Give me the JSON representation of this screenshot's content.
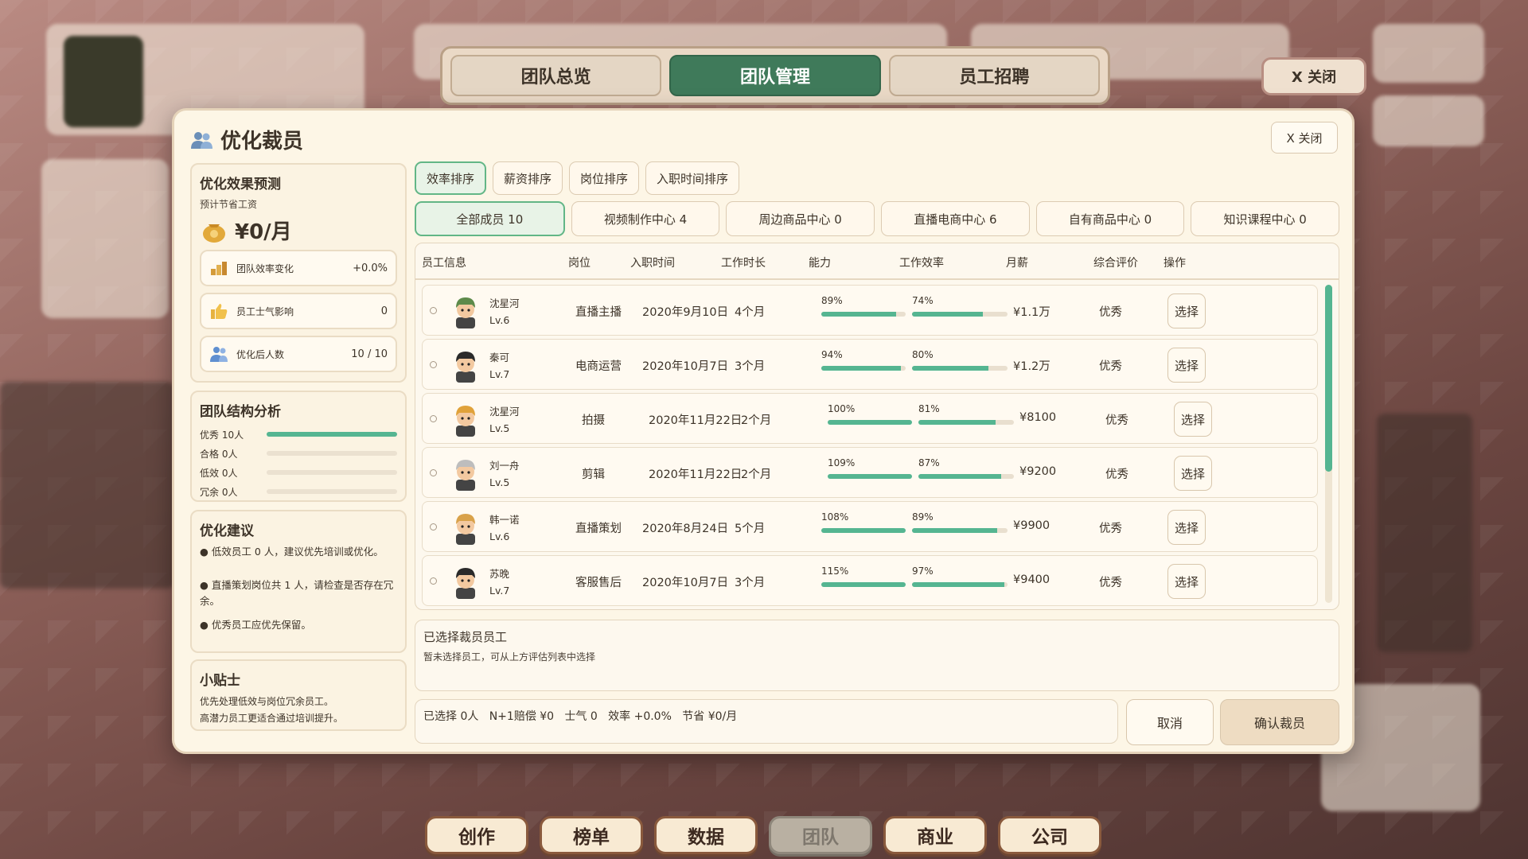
{
  "top_tabs": [
    {
      "label": "团队总览",
      "active": false
    },
    {
      "label": "团队管理",
      "active": true
    },
    {
      "label": "员工招聘",
      "active": false
    }
  ],
  "top_close_label": "X 关闭",
  "modal": {
    "title": "优化裁员",
    "close_label": "X 关闭",
    "left": {
      "forecast": {
        "title": "优化效果预测",
        "subtitle": "预计节省工资",
        "value": "¥0/月",
        "stats": [
          {
            "icon": "team-efficiency-icon",
            "label": "团队效率变化",
            "value": "+0.0%"
          },
          {
            "icon": "thumbs-up-icon",
            "label": "员工士气影响",
            "value": "0"
          },
          {
            "icon": "people-icon",
            "label": "优化后人数",
            "value": "10 / 10"
          }
        ]
      },
      "structure": {
        "title": "团队结构分析",
        "rows": [
          {
            "label": "优秀  10人",
            "fraction": 1.0
          },
          {
            "label": "合格  0人",
            "fraction": 0
          },
          {
            "label": "低效  0人",
            "fraction": 0
          },
          {
            "label": "冗余  0人",
            "fraction": 0
          }
        ]
      },
      "suggestions": {
        "title": "优化建议",
        "items": [
          "● 低效员工 0 人，建议优先培训或优化。",
          "● 直播策划岗位共 1 人，请检查是否存在冗余。",
          "● 优秀员工应优先保留。"
        ]
      },
      "tips": {
        "title": "小贴士",
        "lines": [
          "优先处理低效与岗位冗余员工。",
          "高潜力员工更适合通过培训提升。"
        ]
      }
    },
    "sort_buttons": [
      {
        "label": "效率排序",
        "active": true
      },
      {
        "label": "薪资排序",
        "active": false
      },
      {
        "label": "岗位排序",
        "active": false
      },
      {
        "label": "入职时间排序",
        "active": false
      }
    ],
    "filters": [
      {
        "label": "全部成员 10",
        "active": true
      },
      {
        "label": "视频制作中心 4",
        "active": false
      },
      {
        "label": "周边商品中心 0",
        "active": false
      },
      {
        "label": "直播电商中心 6",
        "active": false
      },
      {
        "label": "自有商品中心 0",
        "active": false
      },
      {
        "label": "知识课程中心 0",
        "active": false
      }
    ],
    "table": {
      "headers": [
        "员工信息",
        "岗位",
        "入职时间",
        "工作时长",
        "能力",
        "工作效率",
        "月薪",
        "综合评价",
        "操作"
      ],
      "rows": [
        {
          "name": "沈星河",
          "level": "Lv.6",
          "role": "直播主播",
          "date": "2020年9月10日",
          "duration": "4个月",
          "ability": "89%",
          "ability_frac": 0.89,
          "efficiency": "74%",
          "efficiency_frac": 0.74,
          "salary": "¥1.1万",
          "rating": "优秀",
          "action": "选择",
          "avatar_color": "#5d8a4a"
        },
        {
          "name": "秦可",
          "level": "Lv.7",
          "role": "电商运营",
          "date": "2020年10月7日",
          "duration": "3个月",
          "ability": "94%",
          "ability_frac": 0.94,
          "efficiency": "80%",
          "efficiency_frac": 0.8,
          "salary": "¥1.2万",
          "rating": "优秀",
          "action": "选择",
          "avatar_color": "#2a2a2a"
        },
        {
          "name": "沈星河",
          "level": "Lv.5",
          "role": "拍摄",
          "date": "2020年11月22日",
          "duration": "2个月",
          "ability": "100%",
          "ability_frac": 1.0,
          "efficiency": "81%",
          "efficiency_frac": 0.81,
          "salary": "¥8100",
          "rating": "优秀",
          "action": "选择",
          "avatar_color": "#e0a23a"
        },
        {
          "name": "刘一舟",
          "level": "Lv.5",
          "role": "剪辑",
          "date": "2020年11月22日",
          "duration": "2个月",
          "ability": "109%",
          "ability_frac": 1.0,
          "efficiency": "87%",
          "efficiency_frac": 0.87,
          "salary": "¥9200",
          "rating": "优秀",
          "action": "选择",
          "avatar_color": "#bdbdbd"
        },
        {
          "name": "韩一诺",
          "level": "Lv.6",
          "role": "直播策划",
          "date": "2020年8月24日",
          "duration": "5个月",
          "ability": "108%",
          "ability_frac": 1.0,
          "efficiency": "89%",
          "efficiency_frac": 0.89,
          "salary": "¥9900",
          "rating": "优秀",
          "action": "选择",
          "avatar_color": "#d9a24a"
        },
        {
          "name": "苏晚",
          "level": "Lv.7",
          "role": "客服售后",
          "date": "2020年10月7日",
          "duration": "3个月",
          "ability": "115%",
          "ability_frac": 1.0,
          "efficiency": "97%",
          "efficiency_frac": 0.97,
          "salary": "¥9400",
          "rating": "优秀",
          "action": "选择",
          "avatar_color": "#2a2a2a"
        }
      ]
    },
    "selected": {
      "title": "已选择裁员员工",
      "hint": "暂未选择员工，可从上方评估列表中选择"
    },
    "summary": "已选择 0人   N+1赔偿 ¥0   士气 0   效率 +0.0%   节省 ¥0/月",
    "cancel_label": "取消",
    "confirm_label": "确认裁员"
  },
  "dock": [
    {
      "label": "创作",
      "active": false
    },
    {
      "label": "榜单",
      "active": false
    },
    {
      "label": "数据",
      "active": false
    },
    {
      "label": "团队",
      "active": true
    },
    {
      "label": "商业",
      "active": false
    },
    {
      "label": "公司",
      "active": false
    }
  ],
  "colors": {
    "accent_green": "#3f7a5a",
    "bar_green": "#55b591",
    "panel_bg": "#fdf6e6",
    "dock_border": "#8a5a3d"
  }
}
